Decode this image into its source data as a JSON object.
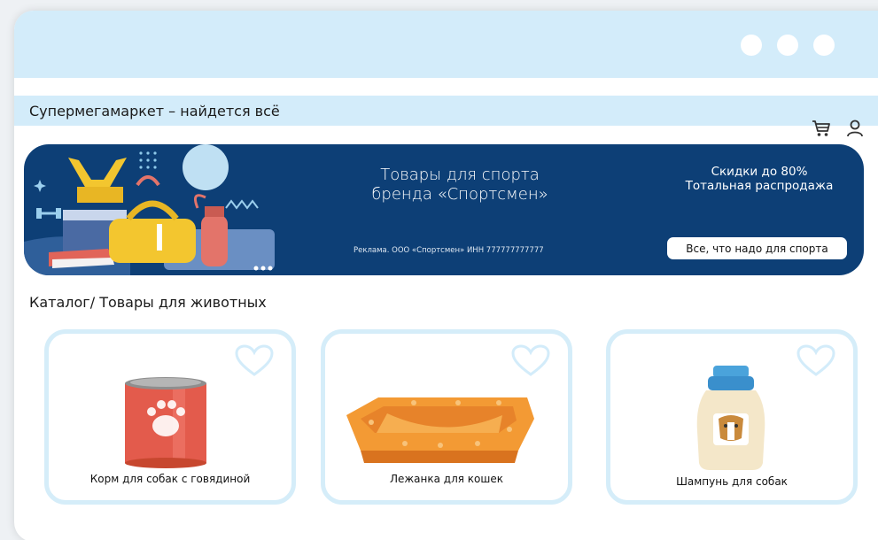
{
  "site": {
    "title": "Супермегамаркет – найдется всё"
  },
  "header_icons": [
    "cart-icon",
    "user-icon"
  ],
  "banner": {
    "title_line1": "Товары для спорта",
    "title_line2": "бренда «Спортсмен»",
    "sale_line1": "Скидки до 80%",
    "sale_line2": "Тотальная распродажа",
    "legal": "Реклама. ООО «Спортсмен» ИНН 777777777777",
    "cta_label": "Все, что надо для спорта"
  },
  "breadcrumb": "Каталог/ Товары для животных",
  "products": [
    {
      "name": "Корм для собак с говядиной",
      "icon": "dog-food-can-image"
    },
    {
      "name": "Лежанка для кошек",
      "icon": "cat-bed-image"
    },
    {
      "name": "Шампунь для собак",
      "icon": "dog-shampoo-image"
    }
  ],
  "colors": {
    "titlebar": "#d3ecfa",
    "banner": "#0d3f76",
    "card_border": "#d5edf9",
    "heart": "#d3ecfa"
  }
}
